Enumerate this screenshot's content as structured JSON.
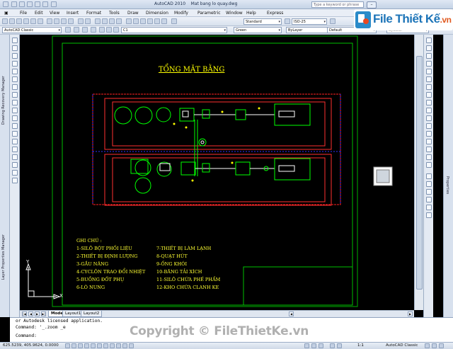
{
  "window": {
    "title": "AutoCAD 2010    Mat bang lo quay.dwg",
    "search_placeholder": "Type a keyword or phrase"
  },
  "menu": [
    "File",
    "Edit",
    "View",
    "Insert",
    "Format",
    "Tools",
    "Draw",
    "Dimension",
    "Modify",
    "Parametric",
    "Window",
    "Help",
    "Express"
  ],
  "toolbar": {
    "workspace": "AutoCAD Classic",
    "layer": "C1",
    "text_style": "Standard",
    "dim_style": "ISO-25",
    "color": "Green",
    "linetype": "ByLayer",
    "lineweight": "Default",
    "plot_style": "ByColor"
  },
  "brand": {
    "name": "File Thiết Kế",
    "suffix": ".vn"
  },
  "palettes": {
    "left_top": "Drawing Recovery Manager",
    "left_bottom": "Layer Properties Manager",
    "right": "Properties"
  },
  "drawing": {
    "title": "TỔNG MẶT BẰNG",
    "legend_heading": "GHI CHÚ :",
    "legend_col1": [
      "1-SILÔ BỘT PHỐI LIỆU",
      "2-THIẾT BỊ ĐỊNH LƯỢNG",
      "3-GẦU NÂNG",
      "4-CYCLÔN TRAO ĐỔI NHIỆT",
      "5-BUỒNG ĐỐT PHỤ",
      "6-LÒ NUNG"
    ],
    "legend_col2": [
      "7-THIẾT BỊ LÀM LẠNH",
      "8-QUẠT HÚT",
      "9-ỐNG KHÓI",
      "10-BĂNG TẢI XÍCH",
      "11-SILÔ CHỨA PHẾ PHẨM",
      "12-KHO CHỨA CLANH KE"
    ],
    "ucs_x": "X",
    "ucs_y": "Y"
  },
  "layout_tabs": [
    "Model",
    "Layout1",
    "Layout2"
  ],
  "command_line": {
    "lines": [
      "or Autodesk licensed application.",
      "Command: '_.zoom _e",
      "Command:"
    ]
  },
  "status_bar": {
    "coordinates": "625.5239, 405.9624, 0.0000",
    "zoom": "1:1",
    "workspace": "AutoCAD Classic"
  },
  "watermark": "Copyright © FileThietKe.vn",
  "colors": {
    "frame": "#00c000",
    "road": "#ff2020",
    "equipment": "#00ff00",
    "text": "#ffff00",
    "command_bg": "#ffffff"
  }
}
